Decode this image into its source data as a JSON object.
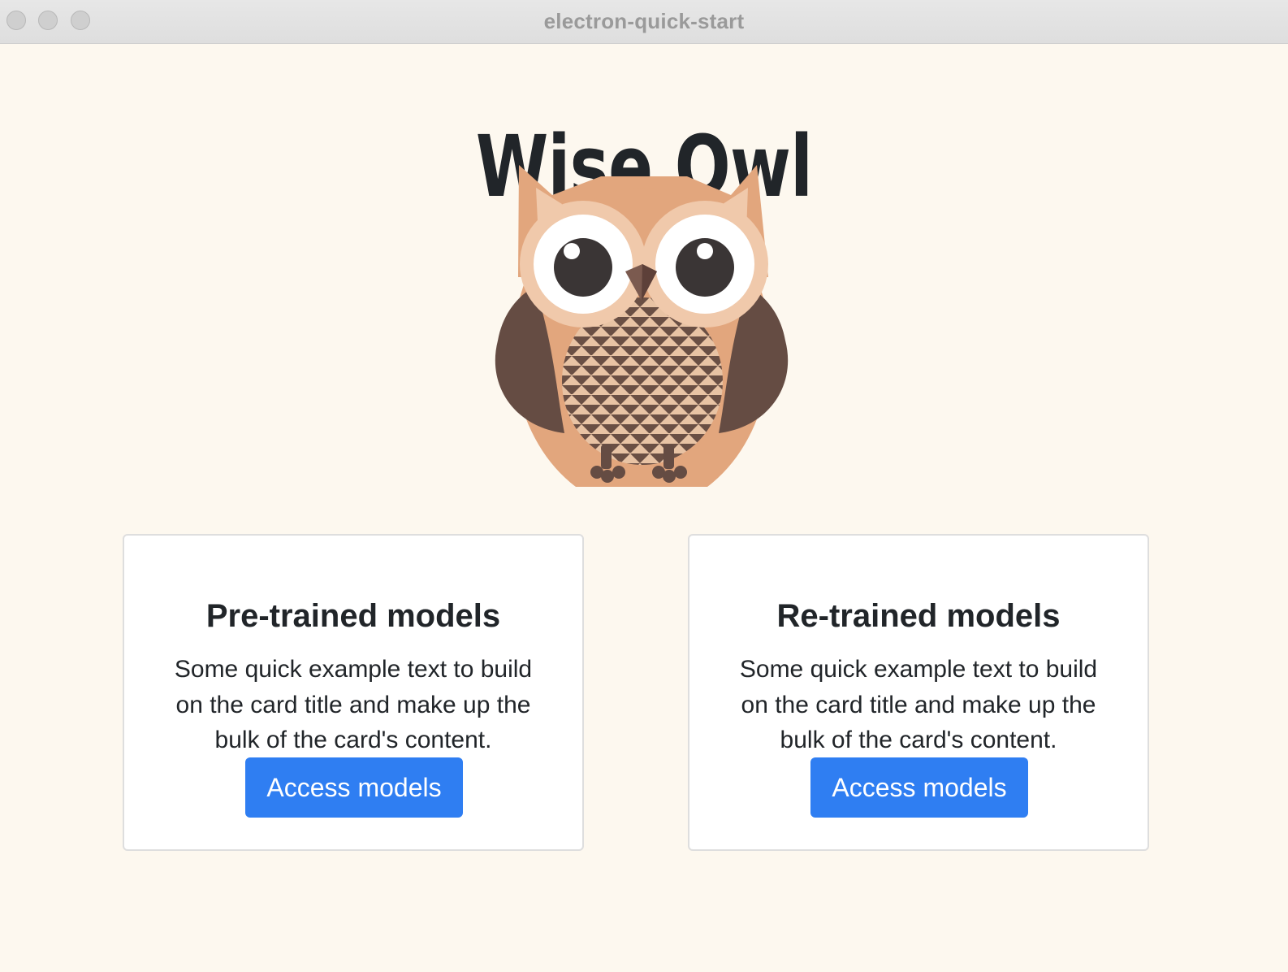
{
  "window": {
    "title": "electron-quick-start"
  },
  "app": {
    "title": "Wise Owl"
  },
  "colors": {
    "background": "#fdf8ef",
    "accent": "#2f7ef2",
    "owl_body": "#e2a67d",
    "owl_wing": "#654c43"
  },
  "icons": {
    "hero": "owl-icon"
  },
  "cards": [
    {
      "title": "Pre-trained models",
      "text": "Some quick example text to build on the card title and make up the bulk of the card's content.",
      "button_label": "Access models"
    },
    {
      "title": "Re-trained models",
      "text": "Some quick example text to build on the card title and make up the bulk of the card's content.",
      "button_label": "Access models"
    }
  ]
}
